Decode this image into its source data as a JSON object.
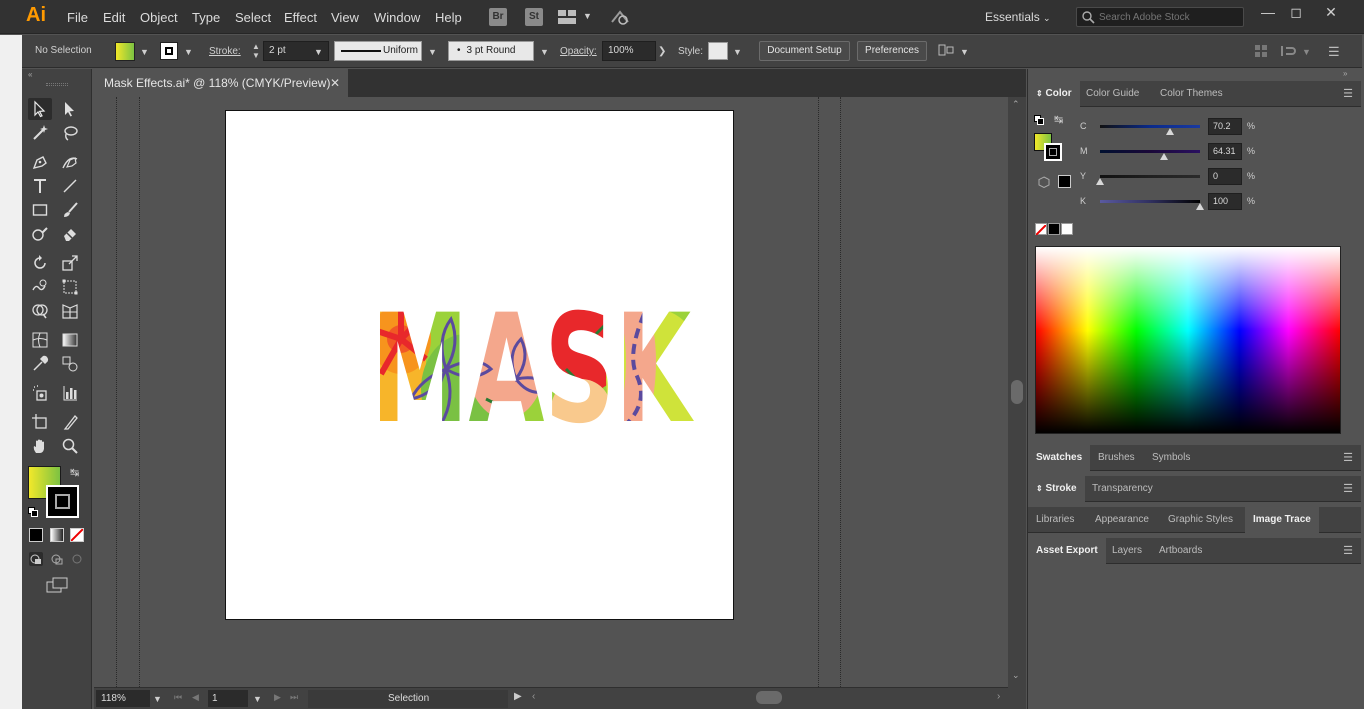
{
  "app": {
    "logo": "Ai"
  },
  "menubar": {
    "items": [
      "File",
      "Edit",
      "Object",
      "Type",
      "Select",
      "Effect",
      "View",
      "Window",
      "Help"
    ],
    "bridge": "Br",
    "stock": "St",
    "workspace": "Essentials",
    "search_placeholder": "Search Adobe Stock"
  },
  "control_bar": {
    "selection": "No Selection",
    "stroke_label": "Stroke:",
    "stroke_weight": "2 pt",
    "profile": "Uniform",
    "brush": "3 pt Round",
    "opacity_label": "Opacity:",
    "opacity_value": "100%",
    "style_label": "Style:",
    "document_setup": "Document Setup",
    "preferences": "Preferences"
  },
  "document": {
    "tab_title": "Mask Effects.ai* @ 118% (CMYK/Preview)",
    "artwork_text": "MASK"
  },
  "statusbar": {
    "zoom": "118%",
    "artboard_number": "1",
    "tool": "Selection"
  },
  "color_panel": {
    "tabs": [
      "Color",
      "Color Guide",
      "Color Themes"
    ],
    "sliders": [
      {
        "name": "C",
        "value": "70.2",
        "fraction": 0.702
      },
      {
        "name": "M",
        "value": "64.31",
        "fraction": 0.6431
      },
      {
        "name": "Y",
        "value": "0",
        "fraction": 0.0
      },
      {
        "name": "K",
        "value": "100",
        "fraction": 1.0
      }
    ],
    "unit": "%"
  },
  "panels": {
    "swatches_group": [
      "Swatches",
      "Brushes",
      "Symbols"
    ],
    "stroke_group": [
      "Stroke",
      "Transparency"
    ],
    "libraries_group": [
      "Libraries",
      "Appearance",
      "Graphic Styles",
      "Image Trace"
    ],
    "export_group": [
      "Asset Export",
      "Layers",
      "Artboards"
    ]
  },
  "colors": {
    "ui_dark": "#323232",
    "ui_mid": "#424242",
    "ui_base": "#535353",
    "logo_orange": "#ff9a00",
    "fill_gradient_start": "#f2e82a",
    "fill_gradient_end": "#7cc242"
  }
}
